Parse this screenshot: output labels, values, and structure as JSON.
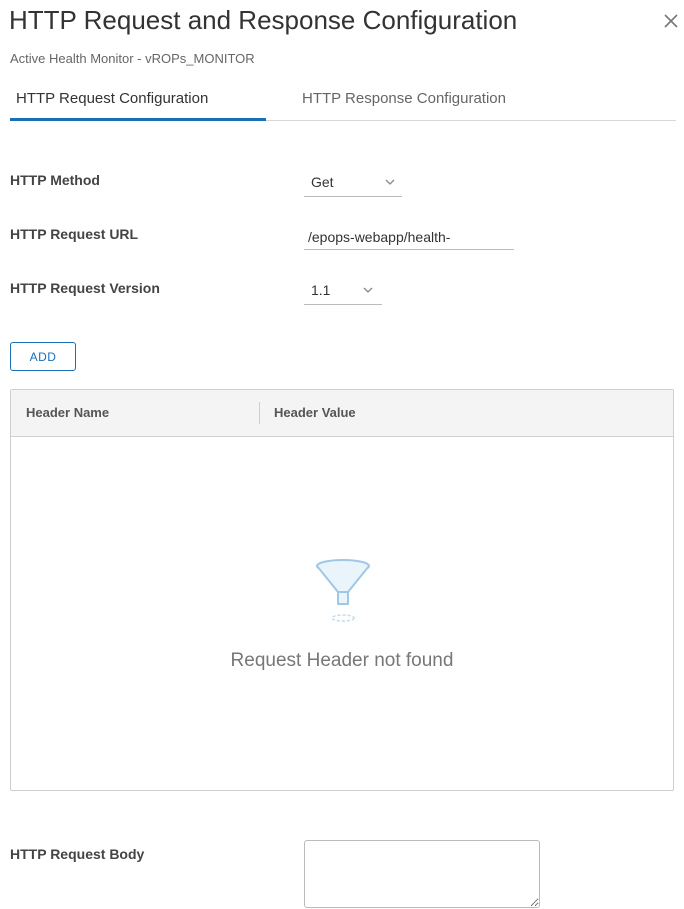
{
  "dialog": {
    "title": "HTTP Request and Response Configuration",
    "subtitle": "Active Health Monitor - vROPs_MONITOR",
    "close_icon": "close-icon"
  },
  "tabs": [
    {
      "label": "HTTP Request Configuration",
      "active": true
    },
    {
      "label": "HTTP Response Configuration",
      "active": false
    }
  ],
  "form": {
    "method_label": "HTTP Method",
    "method_value": "Get",
    "url_label": "HTTP Request URL",
    "url_value": "/epops-webapp/health-",
    "version_label": "HTTP Request Version",
    "version_value": "1.1",
    "body_label": "HTTP Request Body",
    "body_value": ""
  },
  "headers_table": {
    "add_label": "ADD",
    "columns": [
      "Header Name",
      "Header Value"
    ],
    "rows": [],
    "empty_text": "Request Header not found",
    "empty_icon": "filter-icon"
  },
  "colors": {
    "accent": "#1b6fb7",
    "empty_icon": "#9fc7e6"
  }
}
